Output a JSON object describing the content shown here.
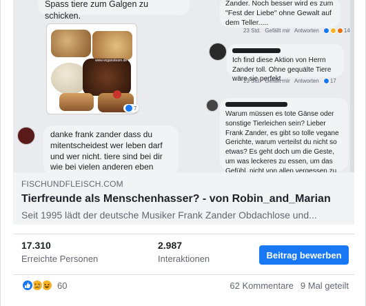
{
  "preview": {
    "top_left_text": "Spass tiere zum Galgen zu schicken.",
    "photo_watermark": "www.vegansteam.de",
    "photo_like_count": "7",
    "danke_text": "danke frank zander dass du mitentscheidest wer leben darf und wer nicht. tiere sind bei dir wie bei vielen anderen eben weniger wert.",
    "zander_text": "Zander. Noch besser wird es zum \"Fest der Liebe\" ohne Gewalt auf dem Teller.....",
    "meta_1": {
      "time": "23 Std.",
      "like": "Gefällt mir",
      "reply": "Antworten",
      "count": "14"
    },
    "ich_text": "Ich find diese Aktion von Herrn Zander toll. Ohne gequälte Tiere wäre sie perfekt.",
    "meta_2": {
      "time": "23 Std.",
      "like": "Gefällt mir",
      "reply": "Antworten",
      "count": "17"
    },
    "warum_text": "Warum müssen es tote Gänse oder sonstige Tierleichen sein? Lieber Frank Zander, es gibt so tolle vegane Gerichte, warum verteilst du nicht so etwas? Es geht doch  um die Geste, um was leckeres zu essen, um das Gefühl, nicht von allen vergessen zu sein. Tote Gänse sind da total daneben"
  },
  "link": {
    "domain": "FISCHUNDFLEISCH.COM",
    "title": "Tierfreunde als Menschenhasser? - von Robin_and_Marian",
    "description": "Seit 1995 lädt der deutsche Musiker Frank Zander Obdachlose und..."
  },
  "stats": {
    "reach_value": "17.310",
    "reach_label": "Erreichte Personen",
    "interactions_value": "2.987",
    "interactions_label": "Interaktionen"
  },
  "boost_label": "Beitrag bewerben",
  "reactions": {
    "icons": [
      "like-icon",
      "sad-icon",
      "haha-icon"
    ],
    "count": "60"
  },
  "engagement": {
    "comments": "62 Kommentare",
    "shares": "9 Mal geteilt"
  },
  "colors": {
    "accent": "#1877f2",
    "link_bg": "#f2f3f5",
    "muted_text": "#606770",
    "reaction_yellow": "#f7b125"
  }
}
